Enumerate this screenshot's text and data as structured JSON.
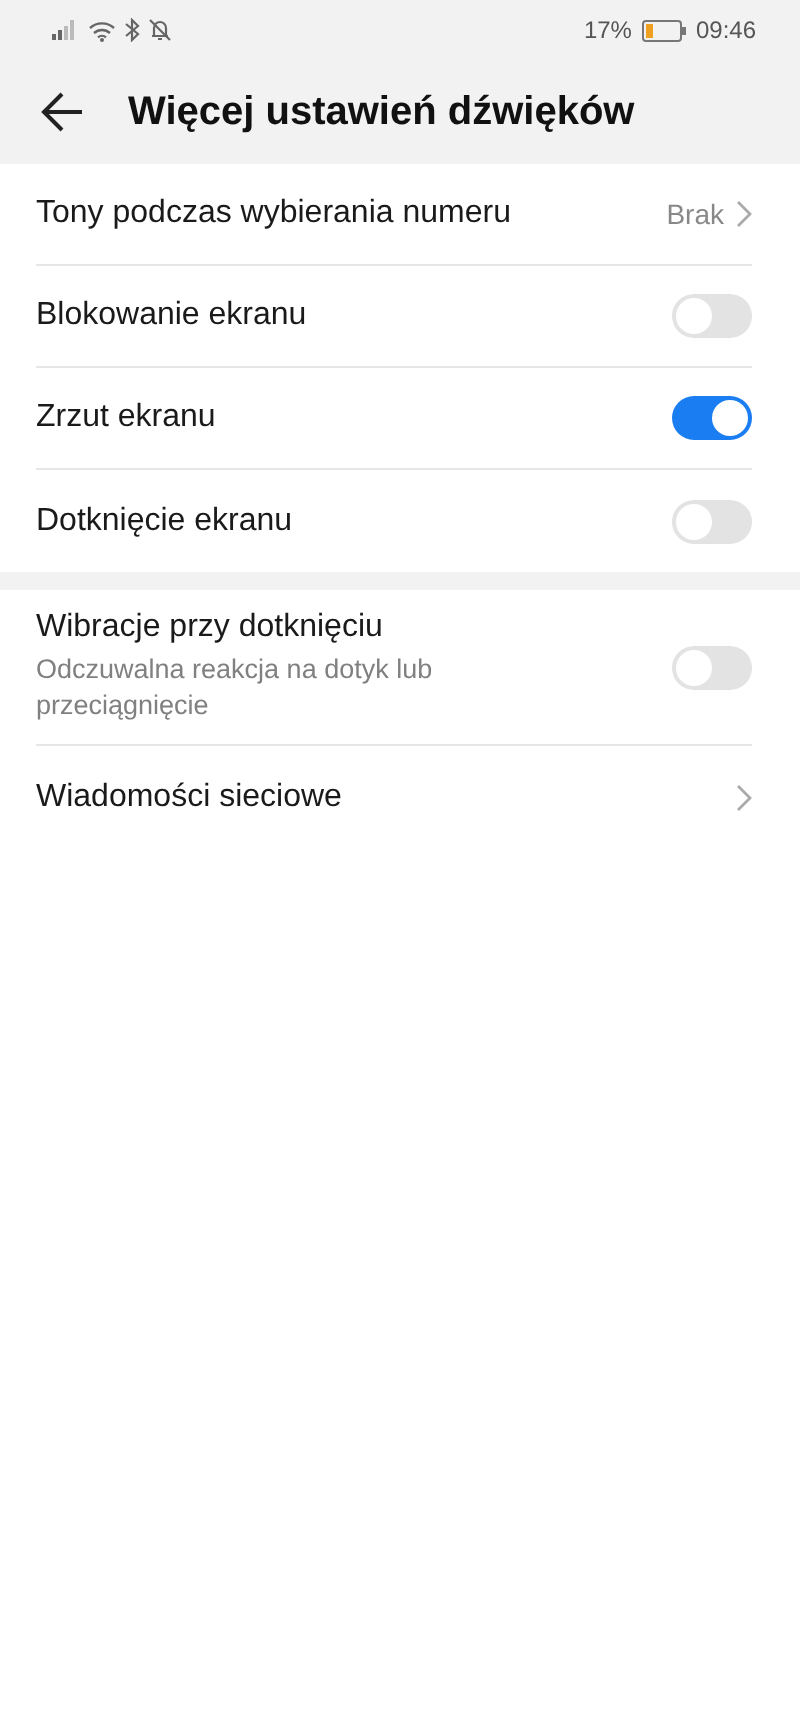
{
  "status_bar": {
    "battery": "17%",
    "time": "09:46"
  },
  "header": {
    "title": "Więcej ustawień dźwięków"
  },
  "sections": [
    {
      "items": [
        {
          "kind": "link",
          "title": "Tony podczas wybierania numeru",
          "value": "Brak"
        },
        {
          "kind": "toggle",
          "title": "Blokowanie ekranu",
          "on": false
        },
        {
          "kind": "toggle",
          "title": "Zrzut ekranu",
          "on": true
        },
        {
          "kind": "toggle",
          "title": "Dotknięcie ekranu",
          "on": false
        }
      ]
    },
    {
      "items": [
        {
          "kind": "toggle",
          "title": "Wibracje przy dotknięciu",
          "subtitle": "Odczuwalna reakcja na dotyk lub przeciągnięcie",
          "on": false
        },
        {
          "kind": "link",
          "title": "Wiadomości sieciowe"
        }
      ]
    }
  ]
}
